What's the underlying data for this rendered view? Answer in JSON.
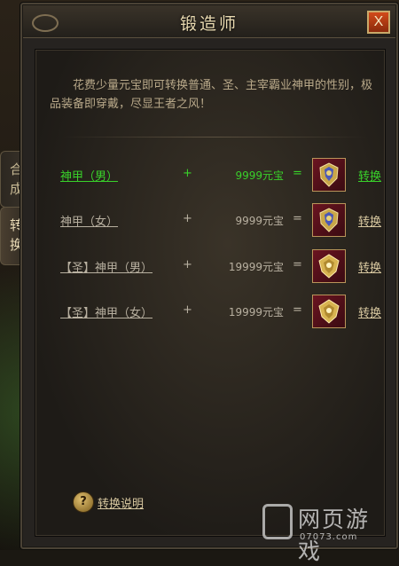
{
  "window": {
    "title": "锻造师",
    "close_label": "X"
  },
  "side_tabs": [
    {
      "label": "合成",
      "active": false
    },
    {
      "label": "转换",
      "active": true
    }
  ],
  "description": "花费少量元宝即可转换普通、圣、主宰霸业神甲的性别，极品装备即穿戴，尽显王者之风！",
  "conversions": [
    {
      "name": "神甲（男）",
      "plus": "+",
      "price": "9999元宝",
      "eq": "=",
      "icon": "armor-icon",
      "action": "转换",
      "highlighted": true
    },
    {
      "name": "神甲（女）",
      "plus": "+",
      "price": "9999元宝",
      "eq": "=",
      "icon": "armor-icon",
      "action": "转换",
      "highlighted": false
    },
    {
      "name": "【圣】神甲（男）",
      "plus": "+",
      "price": "19999元宝",
      "eq": "=",
      "icon": "armor-icon",
      "action": "转换",
      "highlighted": false
    },
    {
      "name": "【圣】神甲（女）",
      "plus": "+",
      "price": "19999元宝",
      "eq": "=",
      "icon": "armor-icon",
      "action": "转换",
      "highlighted": false
    }
  ],
  "help": {
    "icon": "question-icon",
    "icon_glyph": "?",
    "label": "转换说明"
  },
  "watermark": {
    "text": "网页游戏",
    "sub": "07073.com"
  },
  "colors": {
    "highlight_green": "#39d12a",
    "close_button": "#c0401a",
    "text_default": "#b8b0a0"
  }
}
